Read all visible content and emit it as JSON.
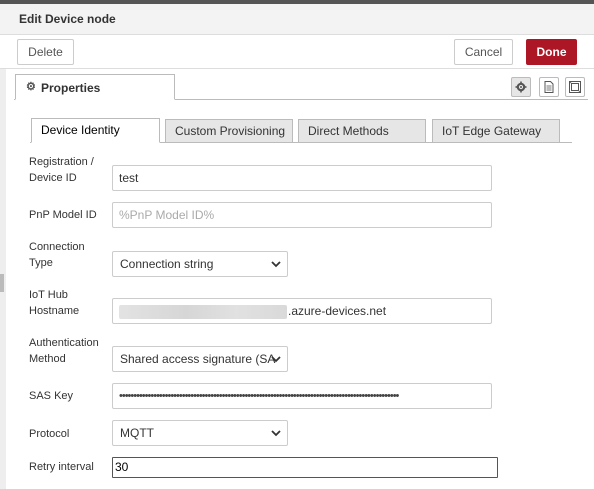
{
  "window": {
    "title": "Edit Device node"
  },
  "toolbar": {
    "delete_label": "Delete",
    "cancel_label": "Cancel",
    "done_label": "Done"
  },
  "node_tabs": {
    "properties_label": "Properties"
  },
  "icons": {
    "settings": "gear-icon",
    "description": "document-icon",
    "appearance": "frame-icon"
  },
  "tabs": [
    {
      "label": "Device Identity",
      "active": true
    },
    {
      "label": "Custom Provisioning",
      "active": false
    },
    {
      "label": "Direct Methods",
      "active": false
    },
    {
      "label": "IoT Edge Gateway",
      "active": false
    }
  ],
  "form": {
    "registration": {
      "label_line1": "Registration /",
      "label_line2": "Device ID",
      "value": "test"
    },
    "pnp": {
      "label": "PnP Model ID",
      "placeholder": "%PnP Model ID%"
    },
    "connection": {
      "label_line1": "Connection",
      "label_line2": "Type",
      "value": "Connection string"
    },
    "hostname": {
      "label_line1": "IoT Hub",
      "label_line2": "Hostname",
      "suffix": ".azure-devices.net"
    },
    "auth": {
      "label_line1": "Authentication",
      "label_line2": "Method",
      "value": "Shared access signature (SA"
    },
    "sas": {
      "label": "SAS Key",
      "value": "••••••••••••••••••••••••••••••••••••••••••••••••••••••••••••••••••••••••••••••••••••••••••••••••••"
    },
    "protocol": {
      "label": "Protocol",
      "value": "MQTT"
    },
    "retry": {
      "label": "Retry interval",
      "value": "30"
    }
  },
  "colors": {
    "primary": "#ad1625",
    "border": "#cccccc",
    "tab_inactive": "#e6e6e6"
  }
}
